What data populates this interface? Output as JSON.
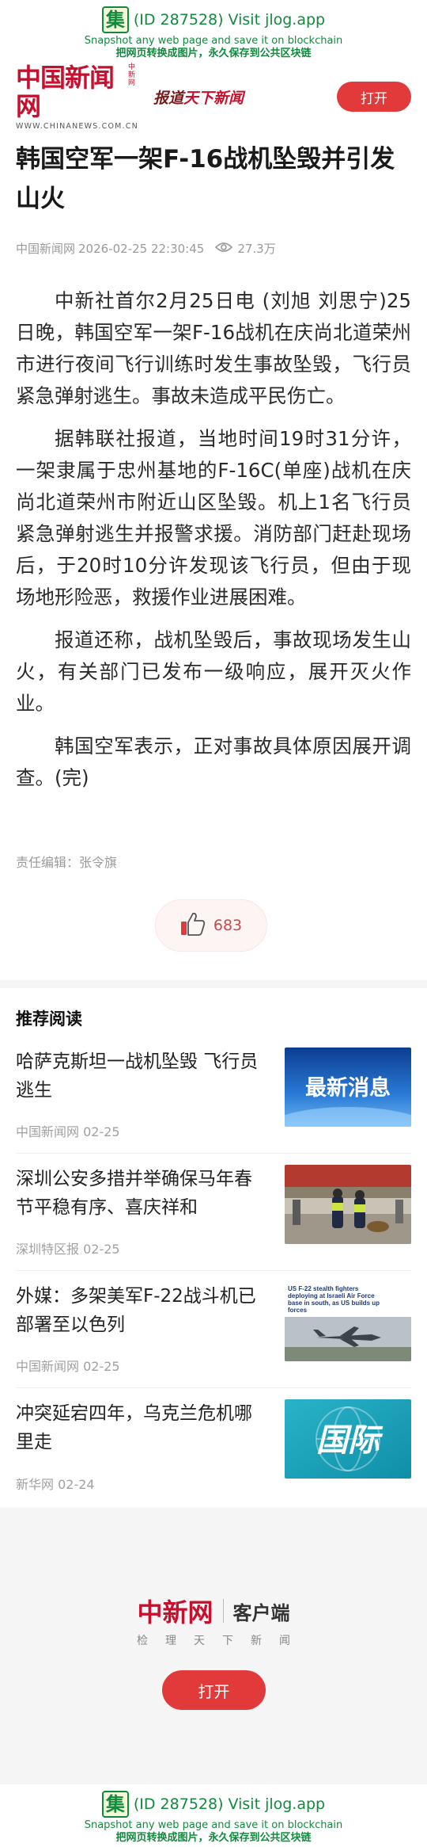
{
  "snapshot": {
    "glyph": "集",
    "id_text": "(ID 287528) Visit jlog.app",
    "line2": "Snapshot any web page and save it on blockchain",
    "line3": "把网页转换成图片，永久保存到公共区块链"
  },
  "header": {
    "logo_text": "中国新闻网",
    "logo_side": "中新网",
    "logo_url": "WWW.CHINANEWS.COM.CN",
    "slogan_pre": "报道",
    "slogan_hl": "天下新闻",
    "open_button": "打开"
  },
  "article": {
    "title": "韩国空军一架F-16战机坠毁并引发山火",
    "source": "中国新闻网",
    "datetime": "2026-02-25 22:30:45",
    "views": "27.3万",
    "paragraphs": [
      "中新社首尔2月25日电 (刘旭 刘思宁)25日晚，韩国空军一架F-16战机在庆尚北道荣州市进行夜间飞行训练时发生事故坠毁，飞行员紧急弹射逃生。事故未造成平民伤亡。",
      "据韩联社报道，当地时间19时31分许，一架隶属于忠州基地的F-16C(单座)战机在庆尚北道荣州市附近山区坠毁。机上1名飞行员紧急弹射逃生并报警求援。消防部门赶赴现场后，于20时10分许发现该飞行员，但由于现场地形险恶，救援作业进展困难。",
      "报道还称，战机坠毁后，事故现场发生山火，有关部门已发布一级响应，展开灭火作业。",
      "韩国空军表示，正对事故具体原因展开调查。(完)"
    ],
    "editor": "责任编辑：张令旗",
    "likes": "683"
  },
  "recommend": {
    "heading": "推荐阅读",
    "items": [
      {
        "title": "哈萨克斯坦一战机坠毁 飞行员逃生",
        "source": "中国新闻网 02-25",
        "thumb": "latest-news",
        "thumb_text": "最新消息"
      },
      {
        "title": "深圳公安多措并举确保马年春节平稳有序、喜庆祥和",
        "source": "深圳特区报 02-25",
        "thumb": "police-photo"
      },
      {
        "title": "外媒：多架美军F-22战斗机已部署至以色列",
        "source": "中国新闻网 02-25",
        "thumb": "jet-photo",
        "thumb_caption": "US F-22 stealth fighters deploying at Israeli Air Force base in south, as US builds up forces"
      },
      {
        "title": "冲突延宕四年，乌克兰危机哪里走",
        "source": "新华网 02-24",
        "thumb": "international",
        "thumb_text": "国际"
      }
    ]
  },
  "footer": {
    "logo": "中新网",
    "client": "客户端",
    "subtitle": "检理天下新闻",
    "open_button": "打开"
  },
  "colors": {
    "brand_red": "#c8102e",
    "button_red": "#e23a3a",
    "snapshot_green": "#128a3e"
  }
}
